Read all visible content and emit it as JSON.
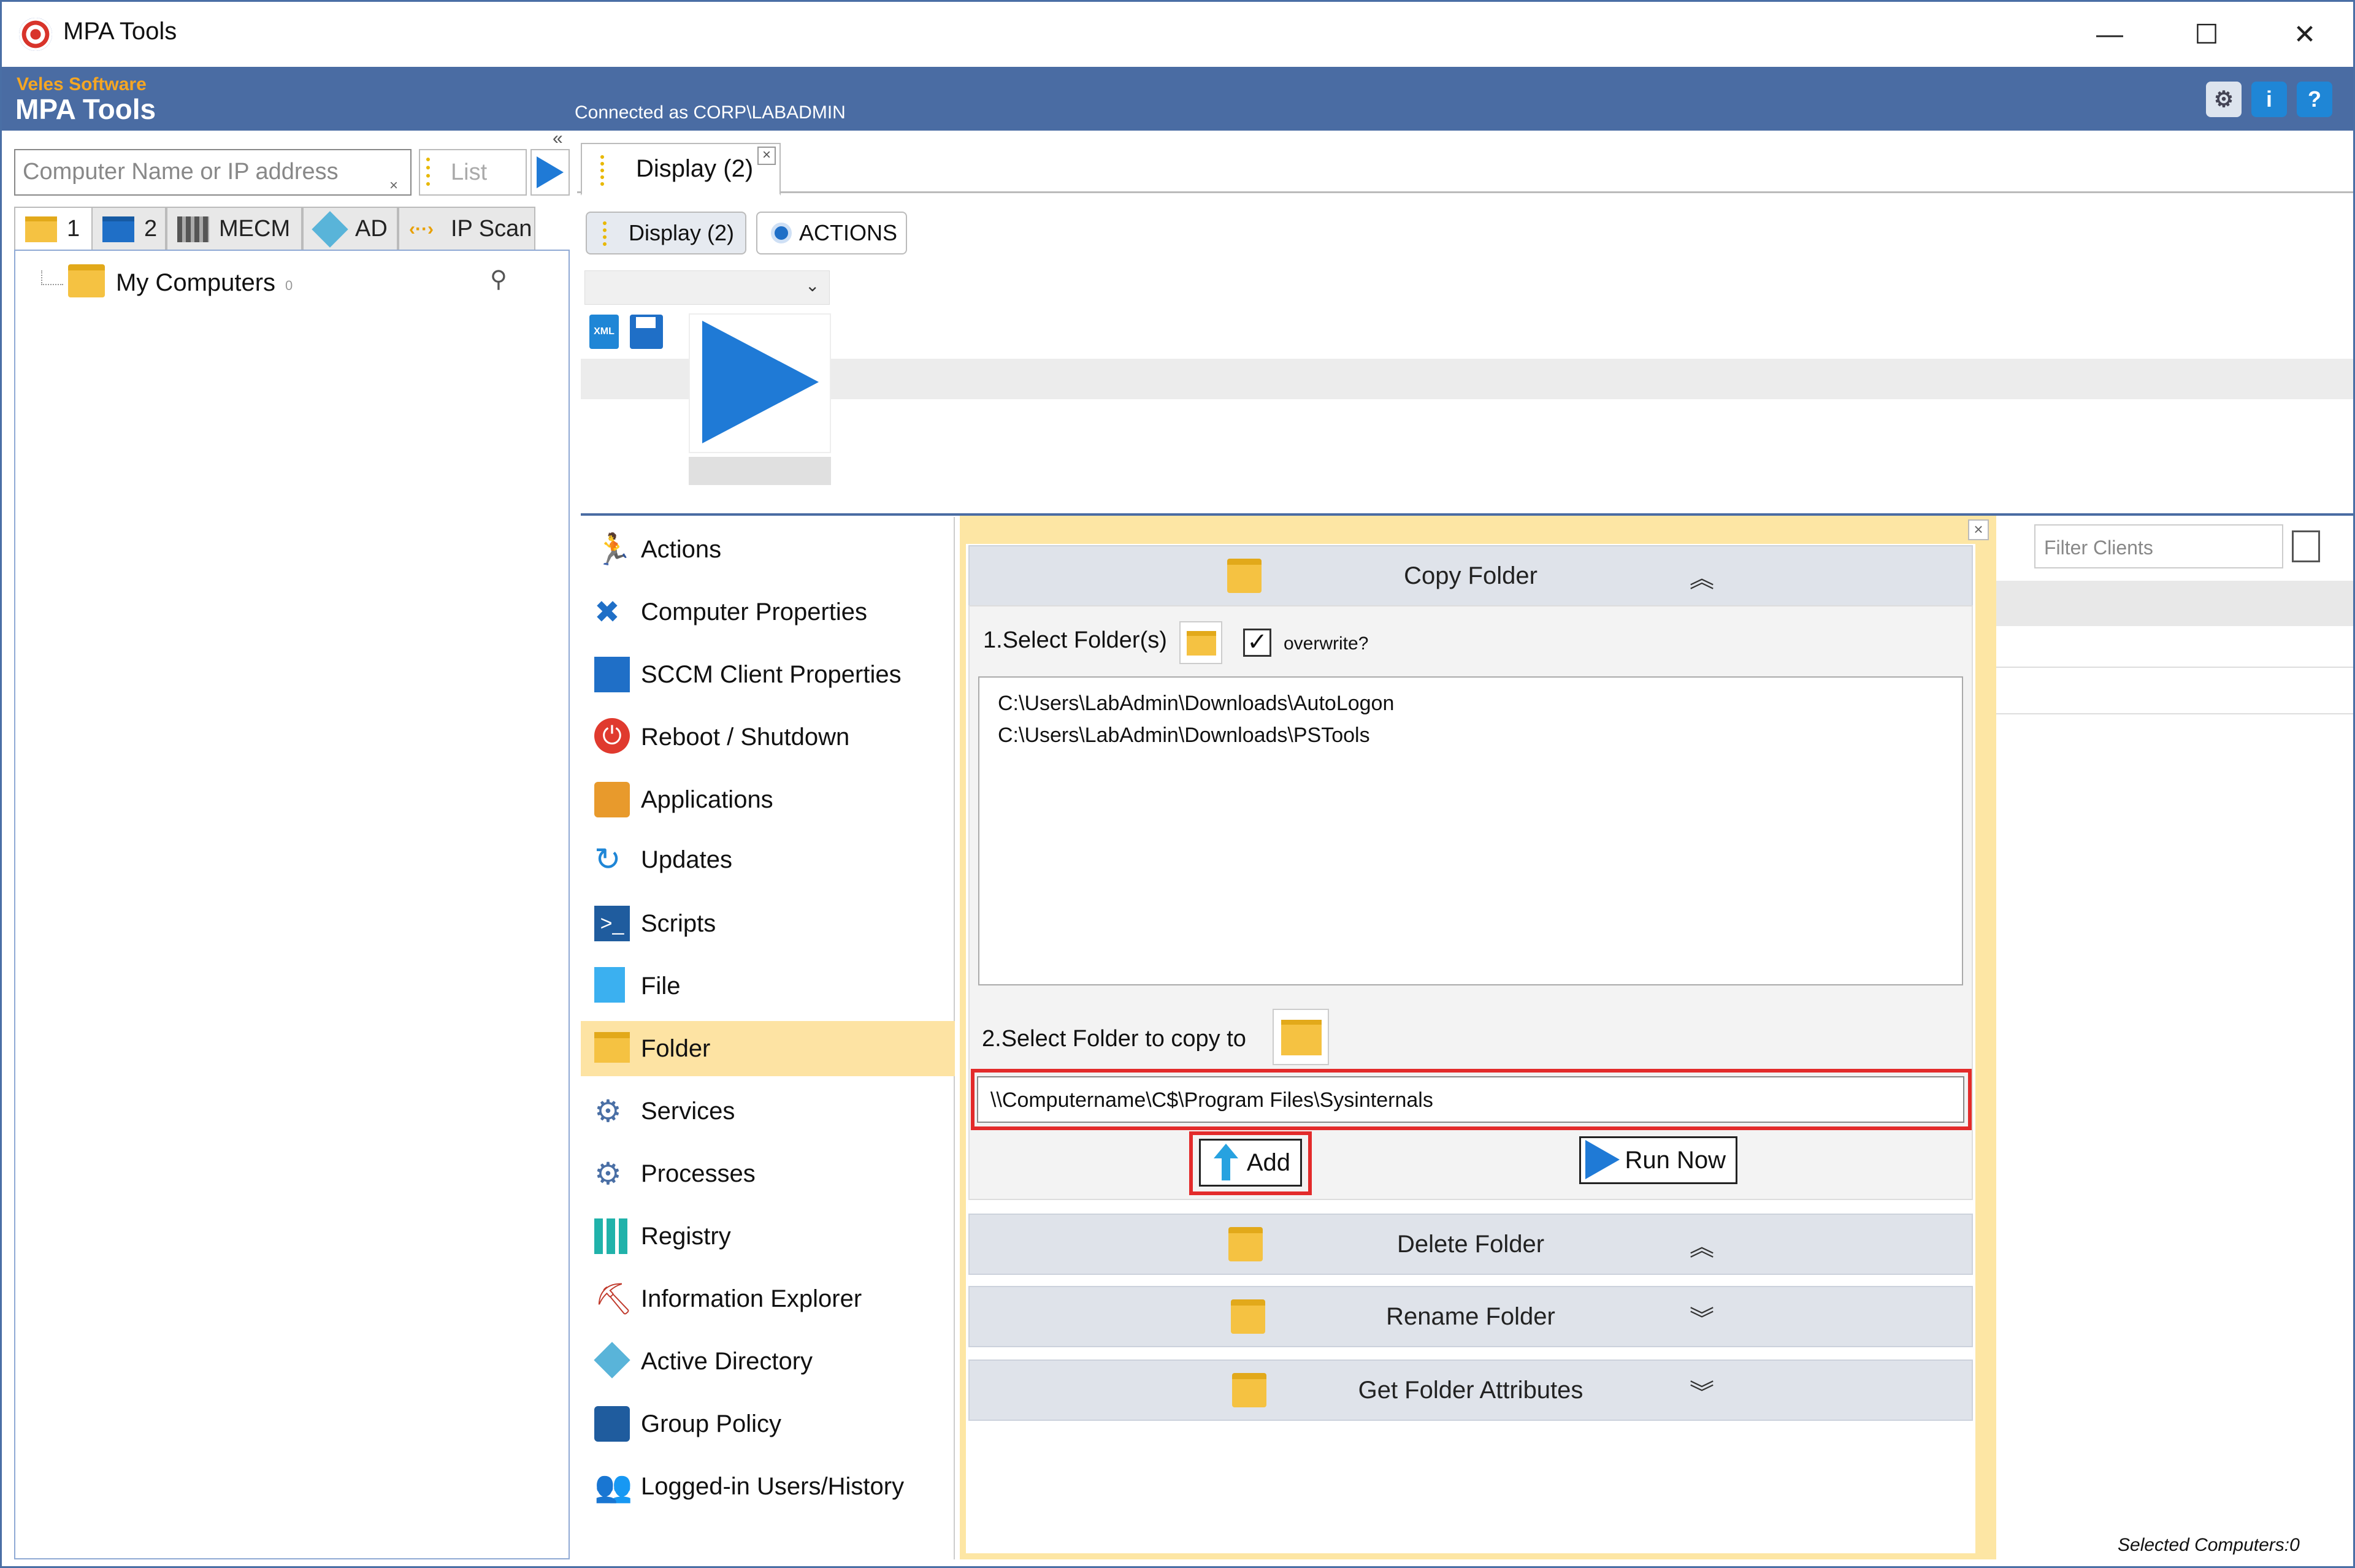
{
  "window": {
    "title": "MPA Tools",
    "min": "—",
    "max": "☐",
    "close": "✕"
  },
  "header": {
    "brand_small": "Veles Software",
    "brand_big": "MPA Tools",
    "connected": "Connected as CORP\\LABADMIN"
  },
  "left": {
    "computer_placeholder": "Computer Name or IP address",
    "list_label": "List",
    "tabs": [
      {
        "label": "1"
      },
      {
        "label": "2"
      },
      {
        "label": "MECM"
      },
      {
        "label": "AD"
      },
      {
        "label": "IP Scan"
      }
    ],
    "tree": {
      "label": "My Computers",
      "count": "0"
    }
  },
  "doc_tab": {
    "label": "Display (2)"
  },
  "sub_tabs": {
    "display": "Display (2)",
    "actions": "ACTIONS"
  },
  "nav": [
    {
      "label": "Actions"
    },
    {
      "label": "Computer Properties"
    },
    {
      "label": "SCCM Client Properties"
    },
    {
      "label": "Reboot / Shutdown"
    },
    {
      "label": "Applications"
    },
    {
      "label": "Updates"
    },
    {
      "label": "Scripts"
    },
    {
      "label": "File"
    },
    {
      "label": "Folder"
    },
    {
      "label": "Services"
    },
    {
      "label": "Processes"
    },
    {
      "label": "Registry"
    },
    {
      "label": "Information Explorer"
    },
    {
      "label": "Active Directory"
    },
    {
      "label": "Group Policy"
    },
    {
      "label": "Logged-in Users/History"
    }
  ],
  "copy_folder": {
    "title": "Copy Folder",
    "step1": "1.Select Folder(s)",
    "overwrite": "overwrite?",
    "folders": [
      "C:\\Users\\LabAdmin\\Downloads\\AutoLogon",
      "C:\\Users\\LabAdmin\\Downloads\\PSTools"
    ],
    "step2": "2.Select Folder to copy to",
    "destination": "\\\\Computername\\C$\\Program Files\\Sysinternals",
    "add_label": "Add",
    "run_label": "Run Now"
  },
  "sections": {
    "delete": "Delete Folder",
    "rename": "Rename Folder",
    "attributes": "Get Folder Attributes"
  },
  "right": {
    "filter_placeholder": "Filter Clients",
    "selected": "Selected Computers:0"
  },
  "colors": {
    "header_blue": "#4a6ca3",
    "accent_orange": "#f5a623",
    "play_blue": "#1f7ad6",
    "highlight_red": "#e32b2b",
    "active_nav": "#fde3a3"
  }
}
